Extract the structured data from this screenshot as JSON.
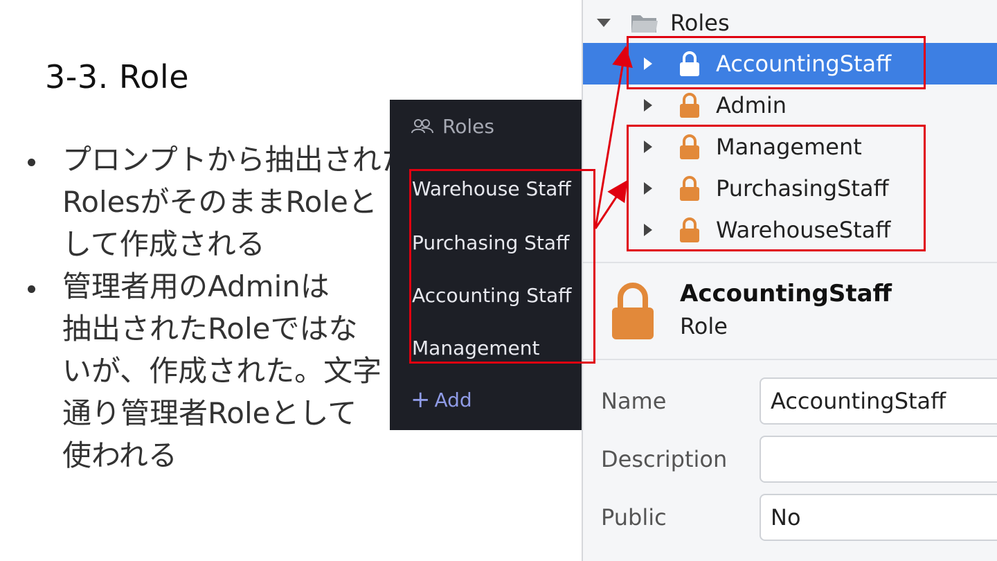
{
  "slide": {
    "title": "3-3. Role",
    "bullets": [
      {
        "lines": [
          "プロンプトから抽出された",
          "RolesがそのままRoleと",
          "して作成される"
        ]
      },
      {
        "lines": [
          "管理者用のAdminは",
          "抽出されたRoleではな",
          "いが、作成された。文字",
          "通り管理者Roleとして",
          "使われる"
        ]
      }
    ]
  },
  "dark_panel": {
    "header": "Roles",
    "items": [
      "Warehouse Staff",
      "Purchasing Staff",
      "Accounting Staff",
      "Management"
    ],
    "add_label": "Add",
    "add_icon": "+"
  },
  "tree": {
    "root_label": "Roles",
    "items": [
      "AccountingStaff",
      "Admin",
      "Management",
      "PurchasingStaff",
      "WarehouseStaff"
    ],
    "selected_index": 0
  },
  "detail": {
    "title": "AccountingStaff",
    "type": "Role",
    "fields": {
      "name_label": "Name",
      "name_value": "AccountingStaff",
      "description_label": "Description",
      "description_value": "",
      "public_label": "Public",
      "public_value": "No"
    }
  },
  "colors": {
    "selection": "#3d7fe3",
    "lock": "#e2893a",
    "highlight": "#e00010",
    "dark_panel_bg": "#1d1f26",
    "add_link": "#8f9be6"
  },
  "icons": {
    "tree_root": "folder-icon",
    "tree_item": "lock-icon",
    "dark_header": "users-icon"
  }
}
